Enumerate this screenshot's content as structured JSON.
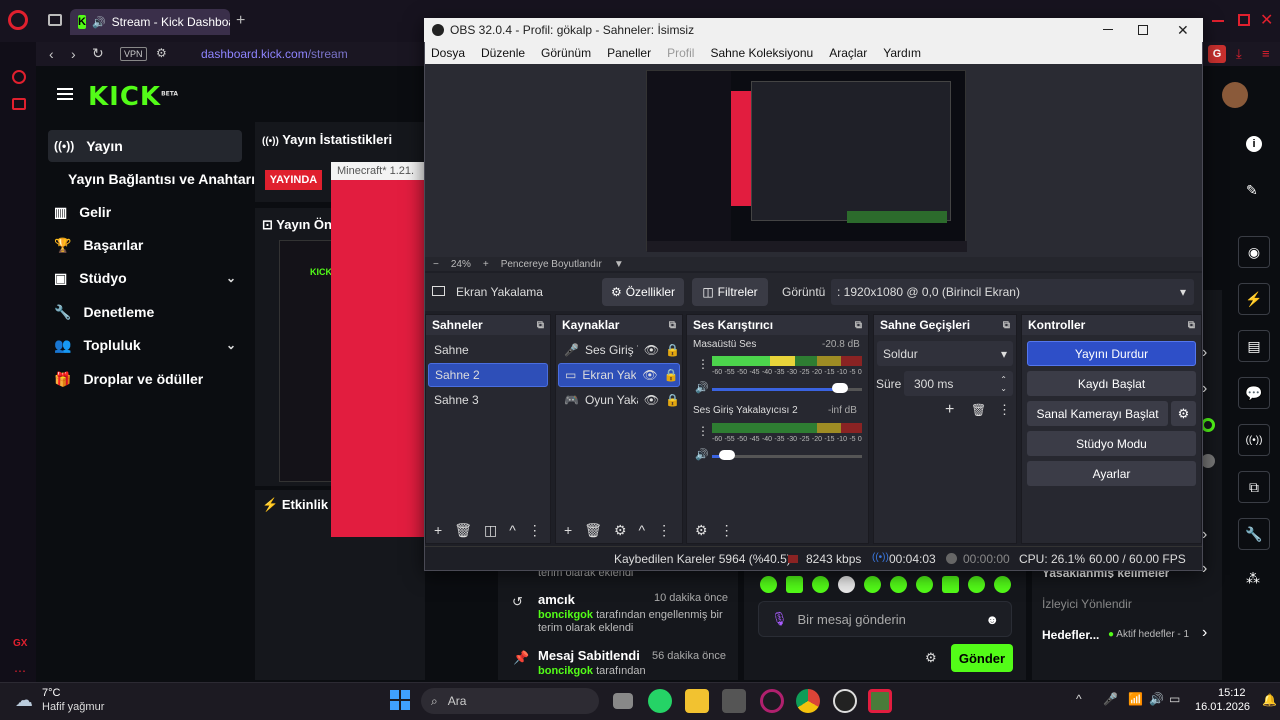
{
  "browser": {
    "tab_title": "Stream - Kick Dashboa",
    "url_domain": "dashboard.kick.com",
    "url_path": "/stream",
    "vpn_label": "VPN",
    "avatar_letter": "G",
    "side_label": "GX"
  },
  "kick": {
    "logo": "KICK",
    "logo_beta": "BETA",
    "sidebar": [
      {
        "label": "Yayın",
        "icon": "broadcast-icon"
      },
      {
        "label": "Yayın Bağlantısı ve Anahtarı",
        "icon": ""
      },
      {
        "label": "Gelir",
        "icon": "chart-icon"
      },
      {
        "label": "Başarılar",
        "icon": "trophy-icon"
      },
      {
        "label": "Stüdyo",
        "icon": "studio-icon"
      },
      {
        "label": "Denetleme",
        "icon": "wrench-icon"
      },
      {
        "label": "Topluluk",
        "icon": "people-icon"
      },
      {
        "label": "Droplar ve ödüller",
        "icon": "gift-icon"
      }
    ],
    "stats_title": "Yayın İstatistikleri",
    "live_badge": "YAYINDA",
    "preview_title": "Yayın Ön",
    "minecraft_title": "Minecraft* 1.21.",
    "activity_title": "Etkinlik A",
    "chat_events": [
      {
        "name": "",
        "time": "",
        "line1": "terim olarak eklendi",
        "line2": ""
      },
      {
        "name": "amcık",
        "time": "10 dakika önce",
        "user": "boncikgok",
        "line1": " tarafından engellenmiş bir",
        "line2": "terim olarak eklendi"
      },
      {
        "name": "Mesaj Sabitlendi",
        "time": "56 dakika önce",
        "user": "boncikgok",
        "line1": " tarafından",
        "line2": ""
      }
    ],
    "chat_placeholder": "Bir mesaj gönderin",
    "send_label": "Gönder",
    "right_panel": {
      "banned_words": "Yasaklanmış kelimeler",
      "viewer_redirect": "İzleyici Yönlendir",
      "goals": "Hedefler...",
      "goals_status": "Aktif hedefler - 1"
    }
  },
  "obs": {
    "title": "OBS 32.0.4 - Profil: gökalp - Sahneler: İsimsiz",
    "menu": [
      "Dosya",
      "Düzenle",
      "Görünüm",
      "Paneller",
      "Profil",
      "Sahne Koleksiyonu",
      "Araçlar",
      "Yardım"
    ],
    "zoom": "24%",
    "fit_label": "Pencereye Boyutlandır",
    "source_name": "Ekran Yakalama",
    "properties_btn": "Özellikler",
    "filters_btn": "Filtreler",
    "display_label": "Görüntü",
    "display_value": ": 1920x1080 @ 0,0 (Birincil Ekran)",
    "scenes_title": "Sahneler",
    "scenes": [
      "Sahne",
      "Sahne 2",
      "Sahne 3"
    ],
    "selected_scene": "Sahne 2",
    "sources_title": "Kaynaklar",
    "sources": [
      {
        "name": "Ses Giriş Y",
        "icon": "mic-icon"
      },
      {
        "name": "Ekran Yak",
        "icon": "monitor-icon"
      },
      {
        "name": "Oyun Yaka",
        "icon": "gamepad-icon"
      }
    ],
    "mixer_title": "Ses Karıştırıcı",
    "mixer": [
      {
        "name": "Masaüstü Ses",
        "db": "-20.8 dB",
        "level": 0.55,
        "volume": 0.85
      },
      {
        "name": "Ses Giriş Yakalayıcısı 2",
        "db": "-inf dB",
        "level": 0.0,
        "volume": 0.1
      }
    ],
    "meter_scale": [
      "-60",
      "-55",
      "-50",
      "-45",
      "-40",
      "-35",
      "-30",
      "-25",
      "-20",
      "-15",
      "-10",
      "-5",
      "0"
    ],
    "transitions_title": "Sahne Geçişleri",
    "transition": "Soldur",
    "duration_label": "Süre",
    "duration_value": "300 ms",
    "controls_title": "Kontroller",
    "controls": [
      "Yayını Durdur",
      "Kaydı Başlat",
      "Sanal Kamerayı Başlat",
      "Stüdyo Modu",
      "Ayarlar"
    ],
    "status": {
      "dropped": "Kaybedilen Kareler 5964 (%40.5)",
      "bitrate": "8243 kbps",
      "stream_time": "00:04:03",
      "rec_time": "00:00:00",
      "cpu": "CPU: 26.1%",
      "fps": "60.00 / 60.00 FPS"
    },
    "colors": {
      "accent": "#2e4fb8",
      "bg": "#1e1f26"
    }
  },
  "taskbar": {
    "weather_temp": "7°C",
    "weather_desc": "Hafif yağmur",
    "search_placeholder": "Ara",
    "time": "15:12",
    "date": "16.01.2026"
  }
}
